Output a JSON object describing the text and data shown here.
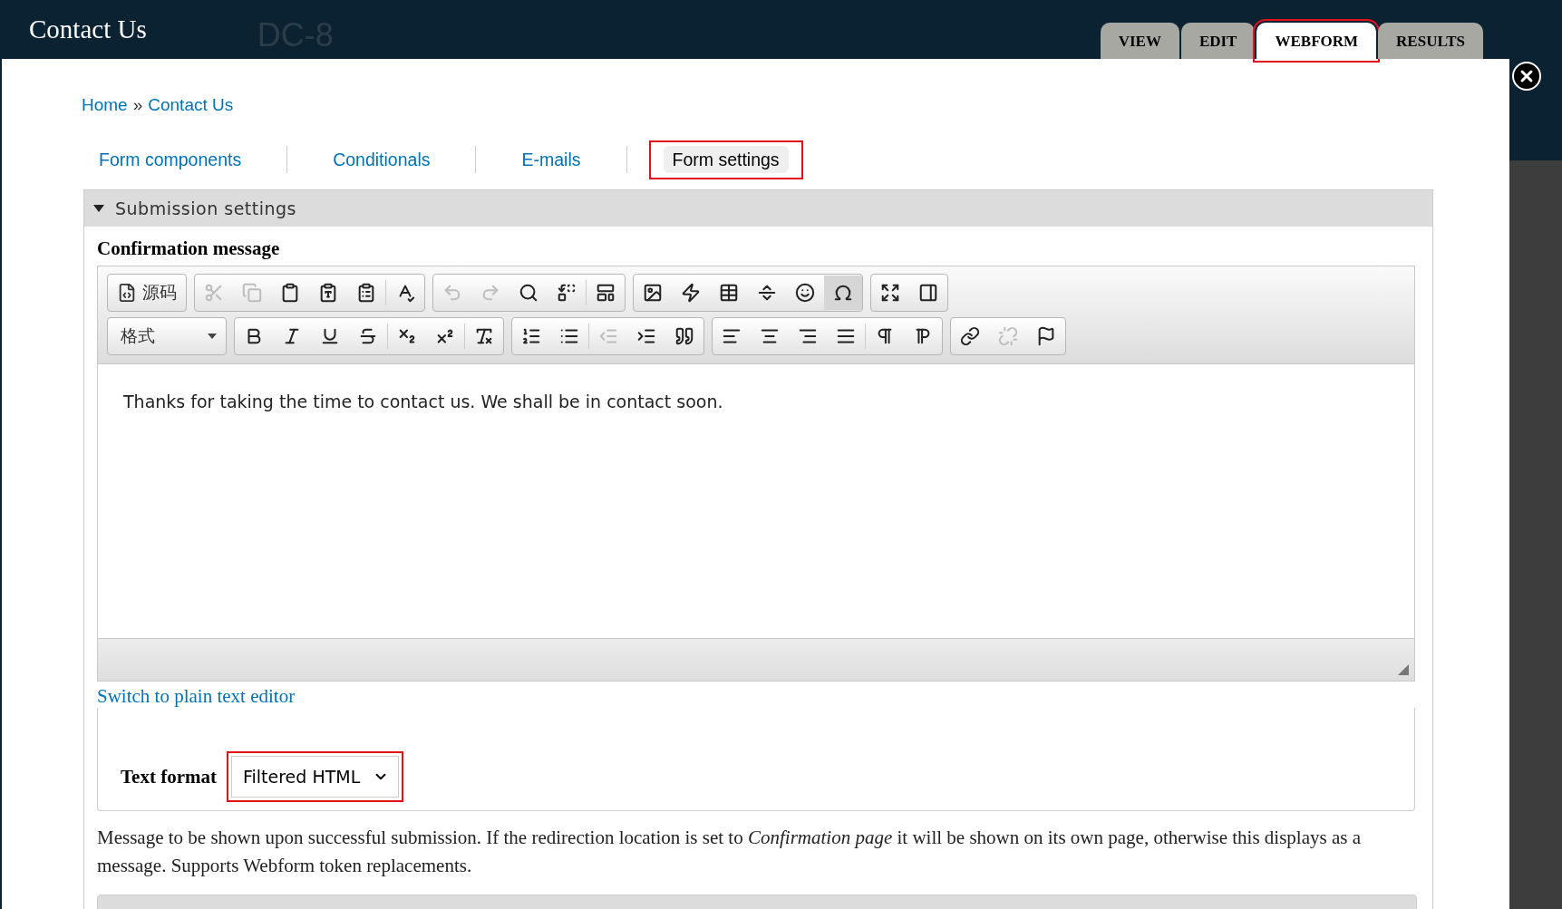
{
  "header": {
    "site_title": "Contact Us",
    "site_name": "DC-8",
    "tabs": [
      {
        "label": "VIEW",
        "selected": false,
        "highlighted": false
      },
      {
        "label": "EDIT",
        "selected": false,
        "highlighted": false
      },
      {
        "label": "WEBFORM",
        "selected": true,
        "highlighted": true
      },
      {
        "label": "RESULTS",
        "selected": false,
        "highlighted": false
      }
    ]
  },
  "breadcrumb": {
    "items": [
      "Home",
      "Contact Us"
    ],
    "separator": "»"
  },
  "subtabs": [
    {
      "label": "Form components",
      "selected": false,
      "highlighted": false
    },
    {
      "label": "Conditionals",
      "selected": false,
      "highlighted": false
    },
    {
      "label": "E-mails",
      "selected": false,
      "highlighted": false
    },
    {
      "label": "Form settings",
      "selected": true,
      "highlighted": true
    }
  ],
  "fieldset": {
    "legend": "Submission settings",
    "expanded": true,
    "field_label": "Confirmation message",
    "editor": {
      "toolbar_rows": [
        [
          [
            {
              "kind": "source",
              "label": "源码"
            }
          ],
          [
            {
              "kind": "cut",
              "disabled": true,
              "on": false
            },
            {
              "kind": "copy",
              "disabled": true,
              "on": false
            },
            {
              "kind": "paste",
              "disabled": false,
              "on": false
            },
            {
              "kind": "paste-text",
              "disabled": false,
              "on": false
            },
            {
              "kind": "paste-word",
              "disabled": false,
              "on": false
            },
            {
              "kind": "separator"
            },
            {
              "kind": "spellcheck",
              "disabled": false,
              "on": false
            }
          ],
          [
            {
              "kind": "undo",
              "disabled": true,
              "on": false
            },
            {
              "kind": "redo",
              "disabled": true,
              "on": false
            },
            {
              "kind": "find",
              "disabled": false,
              "on": false
            },
            {
              "kind": "replace",
              "disabled": false,
              "on": false
            },
            {
              "kind": "separator"
            },
            {
              "kind": "templates",
              "disabled": false,
              "on": false
            }
          ],
          [
            {
              "kind": "image",
              "disabled": false,
              "on": false
            },
            {
              "kind": "flash",
              "disabled": false,
              "on": false
            },
            {
              "kind": "table",
              "disabled": false,
              "on": false
            },
            {
              "kind": "rule",
              "disabled": false,
              "on": false
            },
            {
              "kind": "smiley",
              "disabled": false,
              "on": false
            },
            {
              "kind": "omega",
              "disabled": false,
              "on": true
            }
          ],
          [
            {
              "kind": "maximize",
              "disabled": false,
              "on": false
            },
            {
              "kind": "blocks",
              "disabled": false,
              "on": false
            }
          ]
        ],
        [
          [
            {
              "kind": "combo",
              "label": "格式"
            }
          ],
          [
            {
              "kind": "bold",
              "disabled": false,
              "on": false
            },
            {
              "kind": "italic",
              "disabled": false,
              "on": false
            },
            {
              "kind": "underline",
              "disabled": false,
              "on": false
            },
            {
              "kind": "strike",
              "disabled": false,
              "on": false
            },
            {
              "kind": "separator"
            },
            {
              "kind": "subscript",
              "disabled": false,
              "on": false
            },
            {
              "kind": "superscript",
              "disabled": false,
              "on": false
            },
            {
              "kind": "separator"
            },
            {
              "kind": "clear-format",
              "disabled": false,
              "on": false
            }
          ],
          [
            {
              "kind": "numbered-list",
              "disabled": false,
              "on": false
            },
            {
              "kind": "bullet-list",
              "disabled": false,
              "on": false
            },
            {
              "kind": "separator"
            },
            {
              "kind": "outdent",
              "disabled": true,
              "on": false
            },
            {
              "kind": "indent",
              "disabled": false,
              "on": false
            },
            {
              "kind": "quote",
              "disabled": false,
              "on": false
            }
          ],
          [
            {
              "kind": "align-left",
              "disabled": false,
              "on": false
            },
            {
              "kind": "align-center",
              "disabled": false,
              "on": false
            },
            {
              "kind": "align-right",
              "disabled": false,
              "on": false
            },
            {
              "kind": "align-justify",
              "disabled": false,
              "on": false
            },
            {
              "kind": "separator"
            },
            {
              "kind": "ltr",
              "disabled": false,
              "on": false
            },
            {
              "kind": "rtl",
              "disabled": false,
              "on": false
            }
          ],
          [
            {
              "kind": "link",
              "disabled": false,
              "on": false
            },
            {
              "kind": "unlink",
              "disabled": true,
              "on": false
            },
            {
              "kind": "anchor",
              "disabled": false,
              "on": false
            }
          ]
        ]
      ],
      "content": "Thanks for taking the time to contact us. We shall be in contact soon."
    },
    "switch_link": "Switch to plain text editor",
    "text_format": {
      "label": "Text format",
      "value": "Filtered HTML",
      "highlighted": true
    },
    "description": "Message to be shown upon successful submission. If the redirection location is set to *Confirmation page* it will be shown on its own page, otherwise this displays as a message. Supports Webform token replacements."
  }
}
